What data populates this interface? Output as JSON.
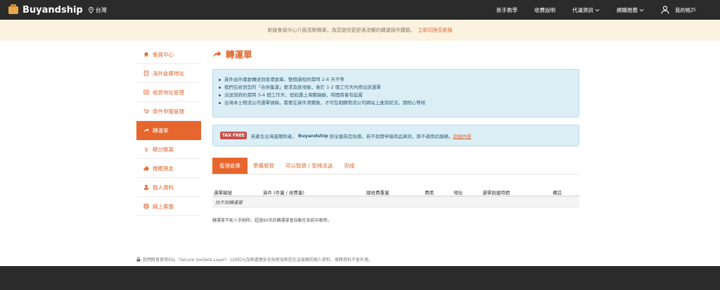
{
  "header": {
    "brand": "Buyandship",
    "region": "台灣",
    "nav": [
      {
        "label": "新手教學",
        "dropdown": false
      },
      {
        "label": "收費說明",
        "dropdown": false
      },
      {
        "label": "代運資訊",
        "dropdown": true
      },
      {
        "label": "網購推薦",
        "dropdown": true
      }
    ],
    "account_label": "我的帳戶"
  },
  "banner": {
    "text": "新版會員中心介面清晰簡單，為您提供更舒適流暢的轉運操作體驗。",
    "link": "立即切換至新版"
  },
  "sidebar": {
    "items": [
      {
        "label": "會員中心",
        "icon": "home-icon"
      },
      {
        "label": "海外倉庫地址",
        "icon": "building-icon"
      },
      {
        "label": "收貨地址管理",
        "icon": "address-icon"
      },
      {
        "label": "貨件申報管理",
        "icon": "cart-icon"
      },
      {
        "label": "轉運單",
        "icon": "share-arrow-icon",
        "active": true
      },
      {
        "label": "積分獎賞",
        "icon": "dollar-icon"
      },
      {
        "label": "推薦朋友",
        "icon": "thumbs-up-icon"
      },
      {
        "label": "個人資料",
        "icon": "person-icon"
      },
      {
        "label": "線上客服",
        "icon": "lifebuoy-icon"
      }
    ]
  },
  "main": {
    "title": "轉運單",
    "info": [
      "貨件由外國倉轉送到香港倉庫，整個過程約需時 2-6 天不等",
      "我們在收到您的「合併集運」要求及款項後，會於 1-2 個工作天內寄出該運單",
      "派送到府約需時 3-4 個工作天，但如遇上海關抽驗，時間將會有延遲",
      "台灣本土物流公司運單號碼，需要在貨件清關後，才可在相關物流公司網站上查詢狀況，請耐心等候"
    ],
    "tax": {
      "badge": "TAX FREE",
      "text1": "若產生台灣進關稅者，",
      "brand": "Buyandship",
      "text2": "將全額為您負擔。若不如實申報商品資訊，將不適用此服務。",
      "link": "詳細內容"
    },
    "tabs": [
      {
        "label": "香港倉庫",
        "active": true
      },
      {
        "label": "準備發貨"
      },
      {
        "label": "可以取貨 / 安排派送"
      },
      {
        "label": "完成"
      }
    ],
    "table": {
      "headers": [
        "運單編號",
        "貨件 (件量 / 收費量)",
        "總收費重量",
        "費用",
        "地址",
        "運單創建時間",
        "備註"
      ],
      "empty": "找不到轉運單"
    },
    "note": "轉運單不能人手刪除，超過90天的轉運單會自動在系統中刪除。"
  },
  "ssl_notice": "我們將會使用SSL（Secure Sockets Layer）128位元加密處理安全技術加密您在這頁面的個人資料，保障資料不會外洩。",
  "colors": {
    "accent": "#e7662e",
    "dark": "#2b2b2b",
    "info_bg": "#dbeef6",
    "banner_bg": "#fcf2e0"
  }
}
